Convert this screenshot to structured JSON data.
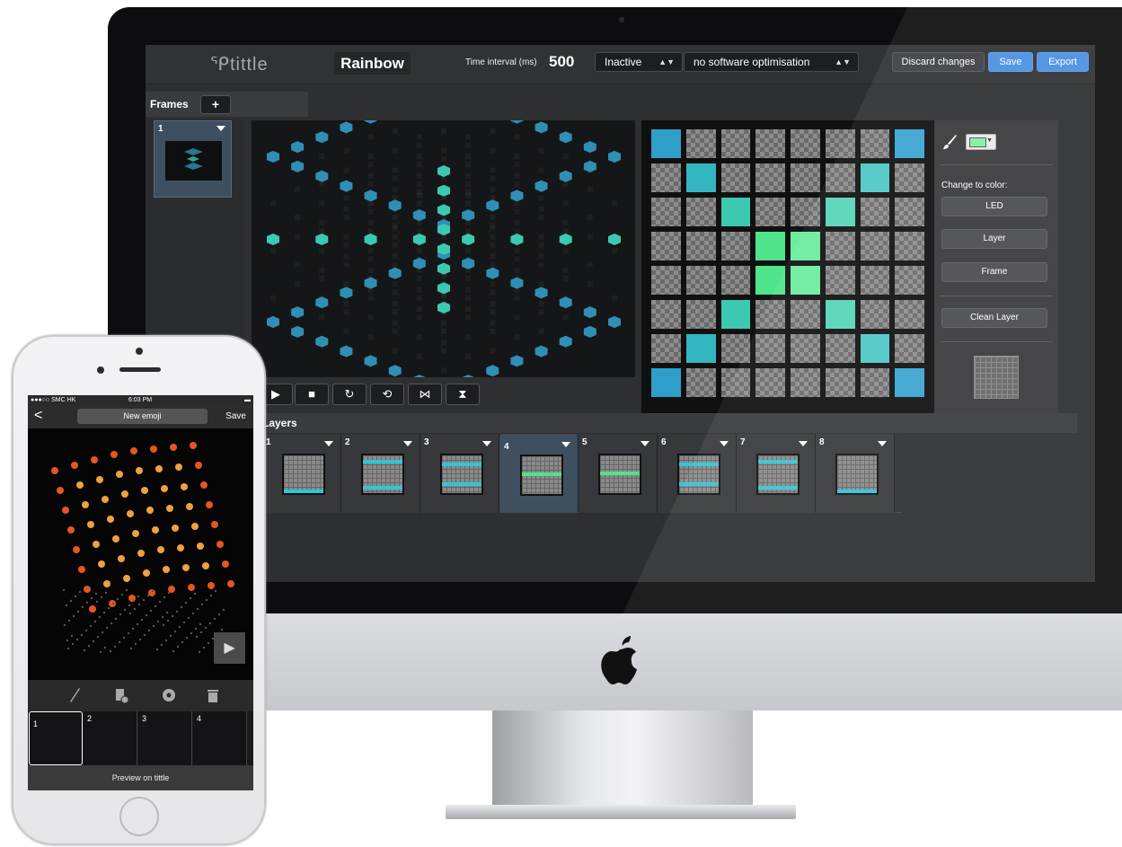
{
  "app": {
    "logo": "ᕿtittle",
    "project_title": "Rainbow",
    "time_interval_label": "Time interval (ms)",
    "time_interval_value": "500",
    "status_select": "Inactive",
    "optimisation_select": "no software optimisation",
    "discard_label": "Discard changes",
    "save_label": "Save",
    "export_label": "Export"
  },
  "frames": {
    "label": "Frames",
    "add_label": "+",
    "items": [
      {
        "number": "1"
      }
    ]
  },
  "playback": {
    "buttons": [
      "▶",
      "■",
      "↻",
      "⟲",
      "⋈",
      "⧗"
    ]
  },
  "tools": {
    "brush_icon": "paintbrush-icon",
    "current_color": "#7ff0a0",
    "change_to_color_label": "Change to color:",
    "led_label": "LED",
    "layer_label": "Layer",
    "frame_label": "Frame",
    "clean_layer_label": "Clean Layer"
  },
  "layers": {
    "label": "Layers",
    "items": [
      {
        "number": "1"
      },
      {
        "number": "2"
      },
      {
        "number": "3"
      },
      {
        "number": "4"
      },
      {
        "number": "5"
      },
      {
        "number": "6"
      },
      {
        "number": "7"
      },
      {
        "number": "8"
      }
    ],
    "selected": "4"
  },
  "led_grid": {
    "rows": [
      [
        "#2f9fc9",
        "",
        "",
        "",
        "",
        "",
        "",
        "#3aa5d2"
      ],
      [
        "",
        "#33b6c0",
        "",
        "",
        "",
        "",
        "#4fc7c5",
        ""
      ],
      [
        "",
        "",
        "#3cc9b2",
        "",
        "",
        "#57d5b6",
        "",
        ""
      ],
      [
        "",
        "",
        "",
        "#4fe38a",
        "#6bed9c",
        "",
        "",
        ""
      ],
      [
        "",
        "",
        "",
        "#4fe38a",
        "#6bed9c",
        "",
        "",
        ""
      ],
      [
        "",
        "",
        "#3cc9b2",
        "",
        "",
        "#57d5b6",
        "",
        ""
      ],
      [
        "",
        "#33b6c0",
        "",
        "",
        "",
        "",
        "#4fc7c5",
        ""
      ],
      [
        "#2f9fc9",
        "",
        "",
        "",
        "",
        "",
        "",
        "#3aa5d2"
      ]
    ]
  },
  "phone": {
    "carrier": "●●●○○ SMC HK",
    "time": "6:03 PM",
    "back_label": "<",
    "title": "New emoji",
    "save_label": "Save",
    "frames": [
      "1",
      "2",
      "3",
      "4"
    ],
    "preview_label": "Preview on tittle"
  }
}
